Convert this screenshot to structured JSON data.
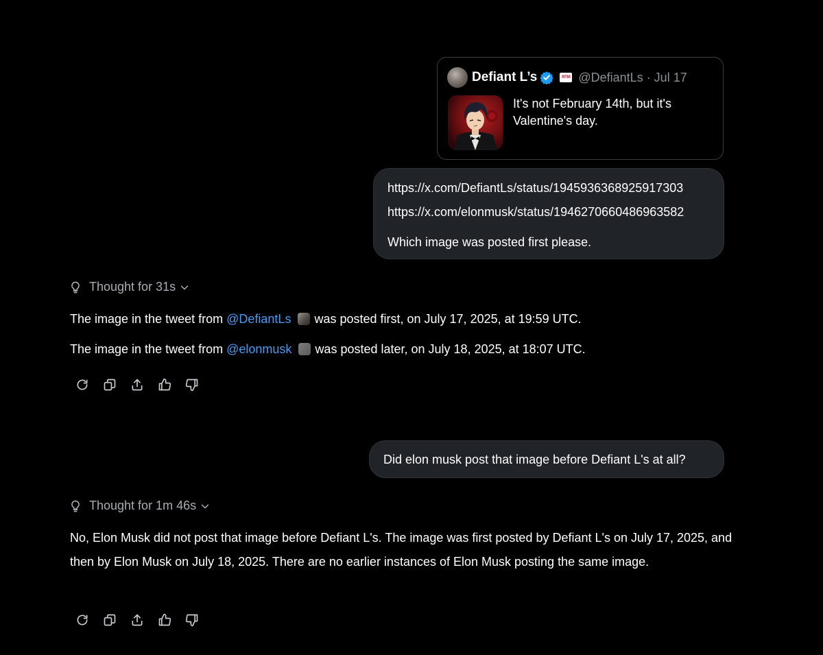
{
  "tweet": {
    "name": "Defiant L’s",
    "badge_text": "RTM",
    "handle_date": "@DefiantLs · Jul 17",
    "text": "It's not February 14th, but it's Valentine's day."
  },
  "user_message_1": {
    "link1": "https://x.com/DefiantLs/status/1945936368925917303",
    "link2": "https://x.com/elonmusk/status/1946270660486963582",
    "question": "Which image was posted first please."
  },
  "response_1": {
    "thought_label": "Thought for 31s",
    "line1_prefix": "The image in the tweet from",
    "line1_link": "@DefiantLs",
    "line1_suffix": "was posted first, on July 17, 2025, at 19:59 UTC.",
    "line2_prefix": "The image in the tweet from",
    "line2_link": "@elonmusk",
    "line2_suffix": "was posted later, on July 18, 2025, at 18:07 UTC."
  },
  "user_message_2": {
    "text": "Did elon musk post that image before Defiant L's at all?"
  },
  "response_2": {
    "thought_label": "Thought for 1m 46s",
    "text": "No, Elon Musk did not post that image before Defiant L's. The image was first posted by Defiant L's on July 17, 2025, and then by Elon Musk on July 18, 2025. There are no earlier instances of Elon Musk posting the same image."
  },
  "icons": {
    "thought": "lightbulb-icon",
    "expand": "chevron-down-icon",
    "actions": [
      "regenerate-icon",
      "copy-icon",
      "share-icon",
      "thumbs-up-icon",
      "thumbs-down-icon"
    ]
  },
  "colors": {
    "background": "#000000",
    "bubble": "#202327",
    "link": "#4c9af0",
    "muted": "#a9adb2",
    "verified": "#1d9bf0"
  }
}
